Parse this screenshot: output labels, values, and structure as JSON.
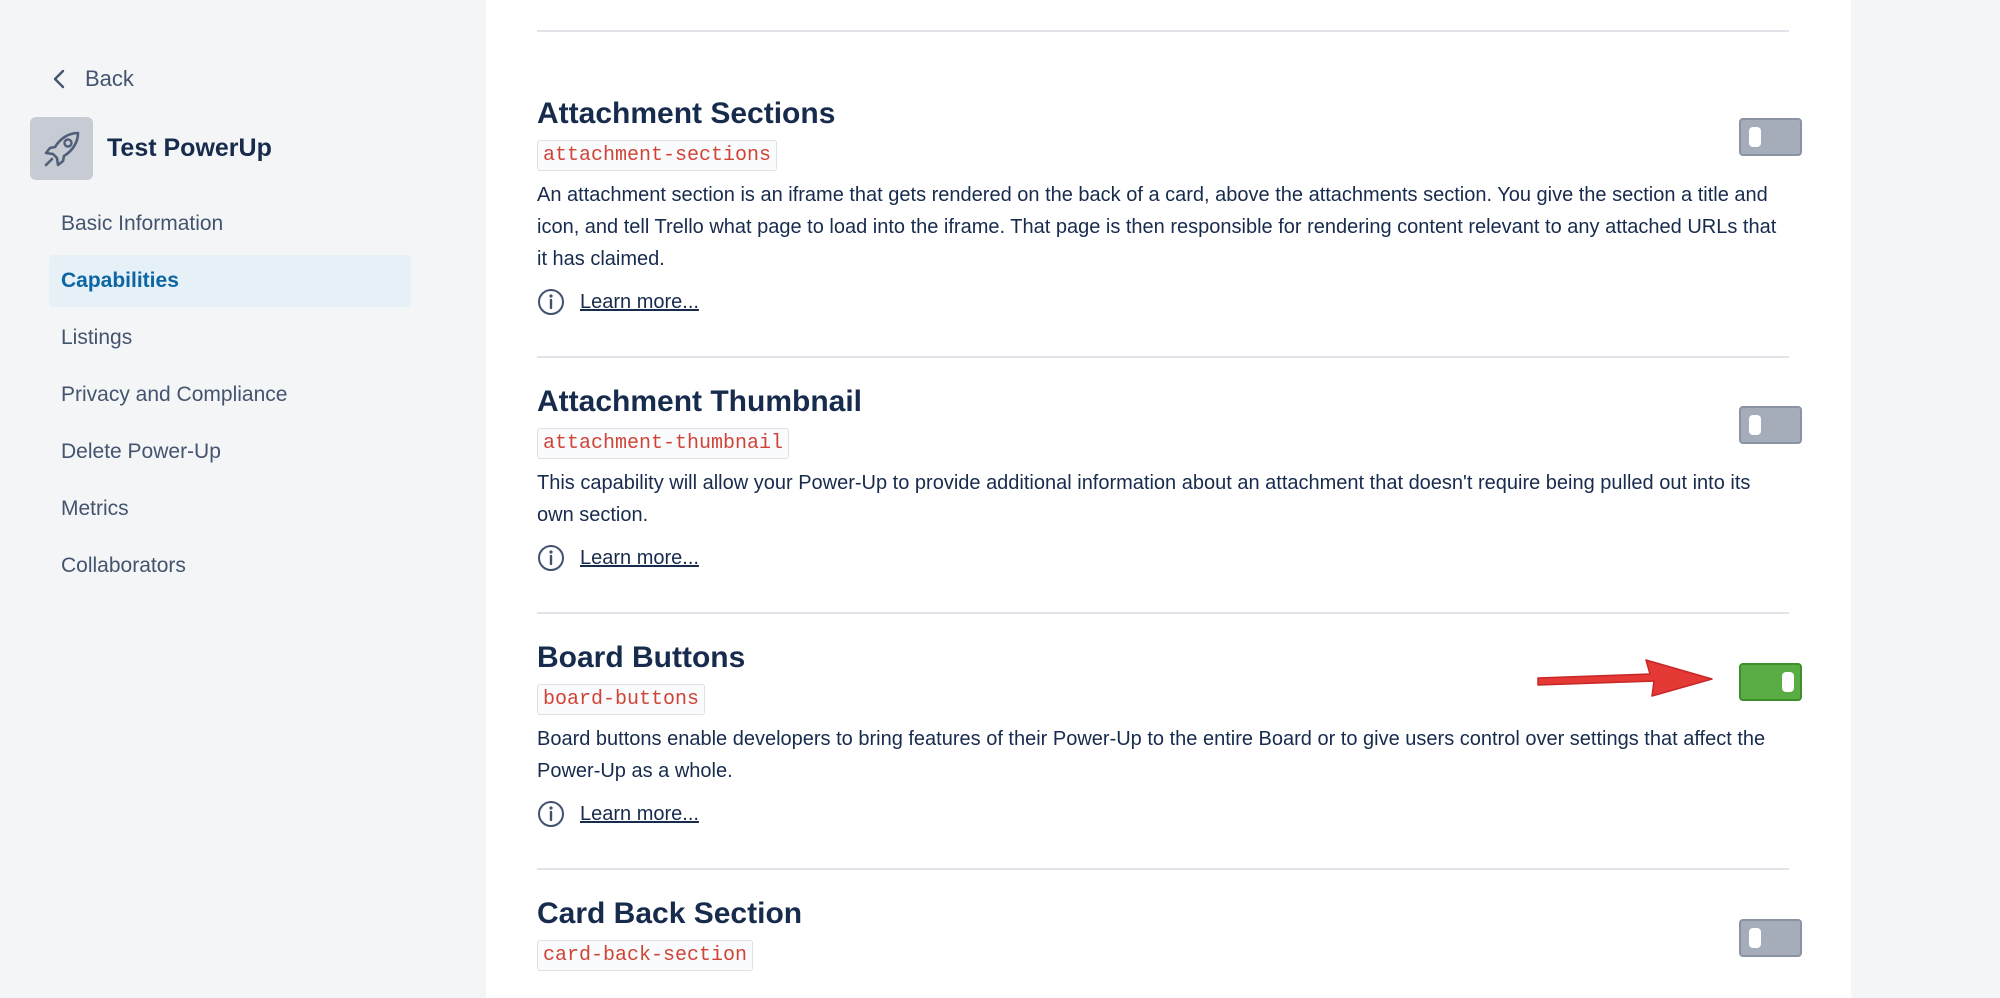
{
  "sidebar": {
    "back_label": "Back",
    "app_name": "Test PowerUp",
    "app_icon": "rocket-icon",
    "items": [
      {
        "label": "Basic Information",
        "active": false
      },
      {
        "label": "Capabilities",
        "active": true
      },
      {
        "label": "Listings",
        "active": false
      },
      {
        "label": "Privacy and Compliance",
        "active": false
      },
      {
        "label": "Delete Power-Up",
        "active": false
      },
      {
        "label": "Metrics",
        "active": false
      },
      {
        "label": "Collaborators",
        "active": false
      }
    ]
  },
  "capabilities": [
    {
      "title": "Attachment Sections",
      "code": "attachment-sections",
      "description": "An attachment section is an iframe that gets rendered on the back of a card, above the attachments section. You give the section a title and icon, and tell Trello what page to load into the iframe. That page is then responsible for rendering content relevant to any attached URLs that it has claimed.",
      "learn_more": "Learn more...",
      "enabled": false
    },
    {
      "title": "Attachment Thumbnail",
      "code": "attachment-thumbnail",
      "description": "This capability will allow your Power-Up to provide additional information about an attachment that doesn't require being pulled out into its own section.",
      "learn_more": "Learn more...",
      "enabled": false
    },
    {
      "title": "Board Buttons",
      "code": "board-buttons",
      "description": "Board buttons enable developers to bring features of their Power-Up to the entire Board or to give users control over settings that affect the Power-Up as a whole.",
      "learn_more": "Learn more...",
      "enabled": true
    },
    {
      "title": "Card Back Section",
      "code": "card-back-section",
      "enabled": false
    }
  ],
  "colors": {
    "toggle_on": "#5aac44",
    "toggle_off": "#a5adba",
    "code_text": "#d04437",
    "active_nav": "#0c66a4",
    "annotation_arrow": "#e53935"
  }
}
